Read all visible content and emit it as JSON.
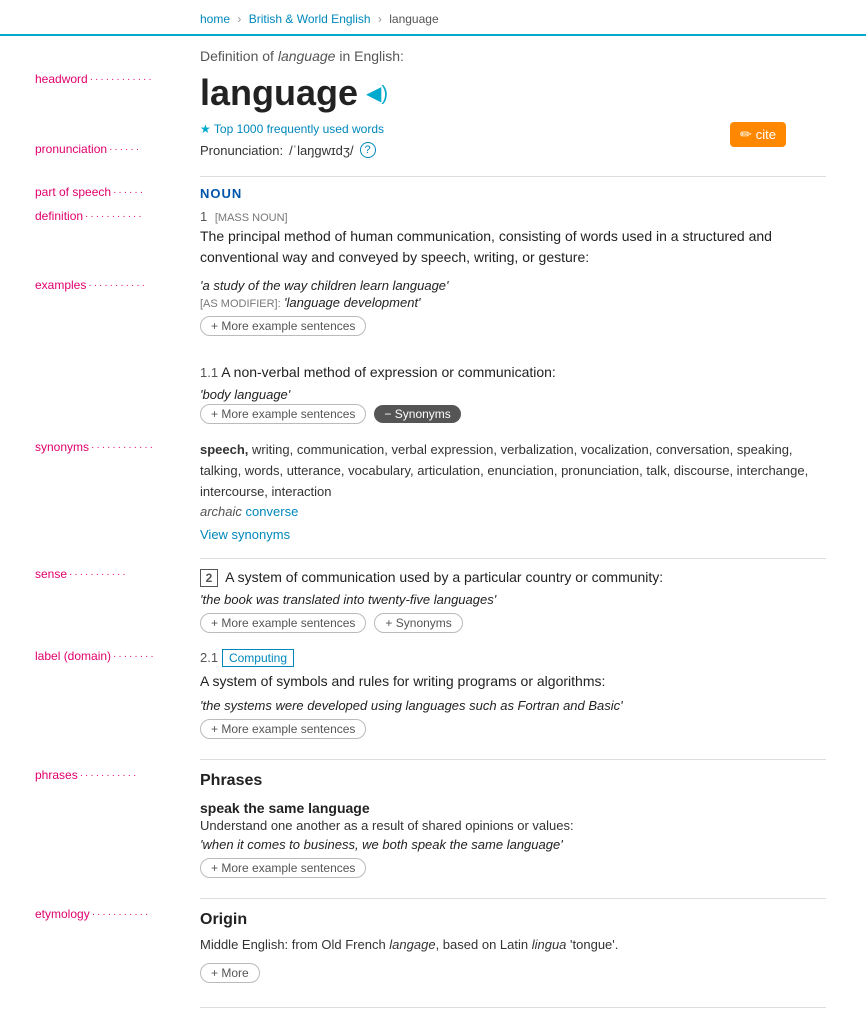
{
  "breadcrumb": {
    "home": "home",
    "section": "British & World English",
    "word": "language"
  },
  "intro": {
    "text": "Definition of ",
    "word": "language",
    "suffix": " in English:"
  },
  "headword": {
    "text": "language",
    "speaker_symbol": "◀)"
  },
  "cite": {
    "label": "cite",
    "icon": "✏"
  },
  "top1000": {
    "text": "Top 1000 frequently used words"
  },
  "pronunciation": {
    "label": "Pronunciation:",
    "ipa": "/ˈlaŋɡwɪdʒ/",
    "help": "?"
  },
  "labels": {
    "headword": "headword",
    "pronunciation": "pronunciation",
    "part_of_speech": "part of speech",
    "definition": "definition",
    "examples": "examples",
    "synonyms": "synonyms",
    "sense": "sense",
    "label_domain": "label (domain)",
    "phrases": "phrases",
    "etymology": "etymology"
  },
  "pos": {
    "label": "NOUN"
  },
  "def1": {
    "number": "1",
    "tag": "[MASS NOUN]",
    "text": "The principal method of human communication, consisting of words used in a structured and conventional way and conveyed by speech, writing, or gesture:"
  },
  "example1": {
    "text": "'a study of the way children learn language'",
    "modifier_tag": "[AS MODIFIER]:",
    "modifier_text": "'language development'"
  },
  "more_examples_btn": "+ More example sentences",
  "sub_def_1_1": {
    "number": "1.1",
    "text": "A non-verbal method of expression or communication:"
  },
  "sub_example_1_1": {
    "text": "'body language'"
  },
  "synonyms_data": {
    "btn_label": "− Synonyms",
    "more_btn": "+ More example sentences",
    "words": "speech, writing, communication, verbal expression, verbalization, vocalization, conversation, speaking, talking, words, utterance, vocabulary, articulation, enunciation, pronunciation, talk, discourse, interchange, intercourse, interaction",
    "archaic_label": "archaic",
    "archaic_word": "converse",
    "view_link": "View synonyms"
  },
  "sense2": {
    "number": "2",
    "text": "A system of communication used by a particular country or community:",
    "example": "'the book was translated into twenty-five languages'",
    "more_btn": "+ More example sentences",
    "synonyms_btn": "+ Synonyms"
  },
  "def2_1": {
    "number": "2.1",
    "domain": "Computing",
    "text": "A system of symbols and rules for writing programs or algorithms:",
    "example": "'the systems were developed using languages such as Fortran and Basic'",
    "more_btn": "+ More example sentences"
  },
  "phrases": {
    "heading": "Phrases",
    "items": [
      {
        "title": "speak the same language",
        "def": "Understand one another as a result of shared opinions or values:",
        "example": "'when it comes to business, we both speak the same language'",
        "more_btn": "+ More example sentences"
      }
    ]
  },
  "etymology": {
    "heading": "Origin",
    "text_parts": [
      "Middle English: from Old French ",
      "langage",
      ", based on Latin ",
      "lingua",
      " 'tongue'."
    ],
    "more_btn": "+ More"
  }
}
